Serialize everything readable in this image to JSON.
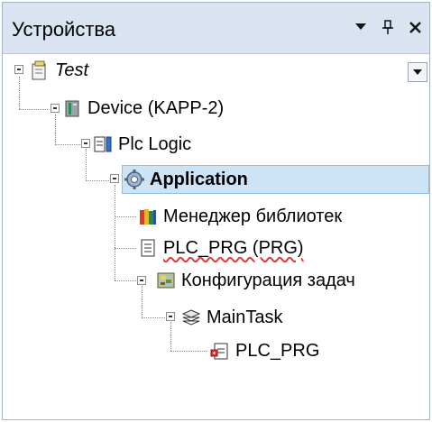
{
  "panel": {
    "title": "Устройства",
    "buttons": {
      "dropdown_icon": "▾",
      "pin_icon": "⊥",
      "close_icon": "✕"
    }
  },
  "tree": {
    "root": {
      "label": "Test"
    },
    "device": {
      "label": "Device (KAPP-2)"
    },
    "plc_logic": {
      "label": "Plc Logic"
    },
    "application": {
      "label": "Application"
    },
    "library_manager": {
      "label": "Менеджер библиотек"
    },
    "plc_prg_prg": {
      "label": "PLC_PRG (PRG)"
    },
    "task_config": {
      "label": "Конфигурация задач"
    },
    "main_task": {
      "label": "MainTask"
    },
    "plc_prg": {
      "label": "PLC_PRG"
    }
  },
  "colors": {
    "titlebar_bg": "#d9e3f2",
    "selection_bg": "#cde4f7",
    "link": "#0b1fd6"
  }
}
